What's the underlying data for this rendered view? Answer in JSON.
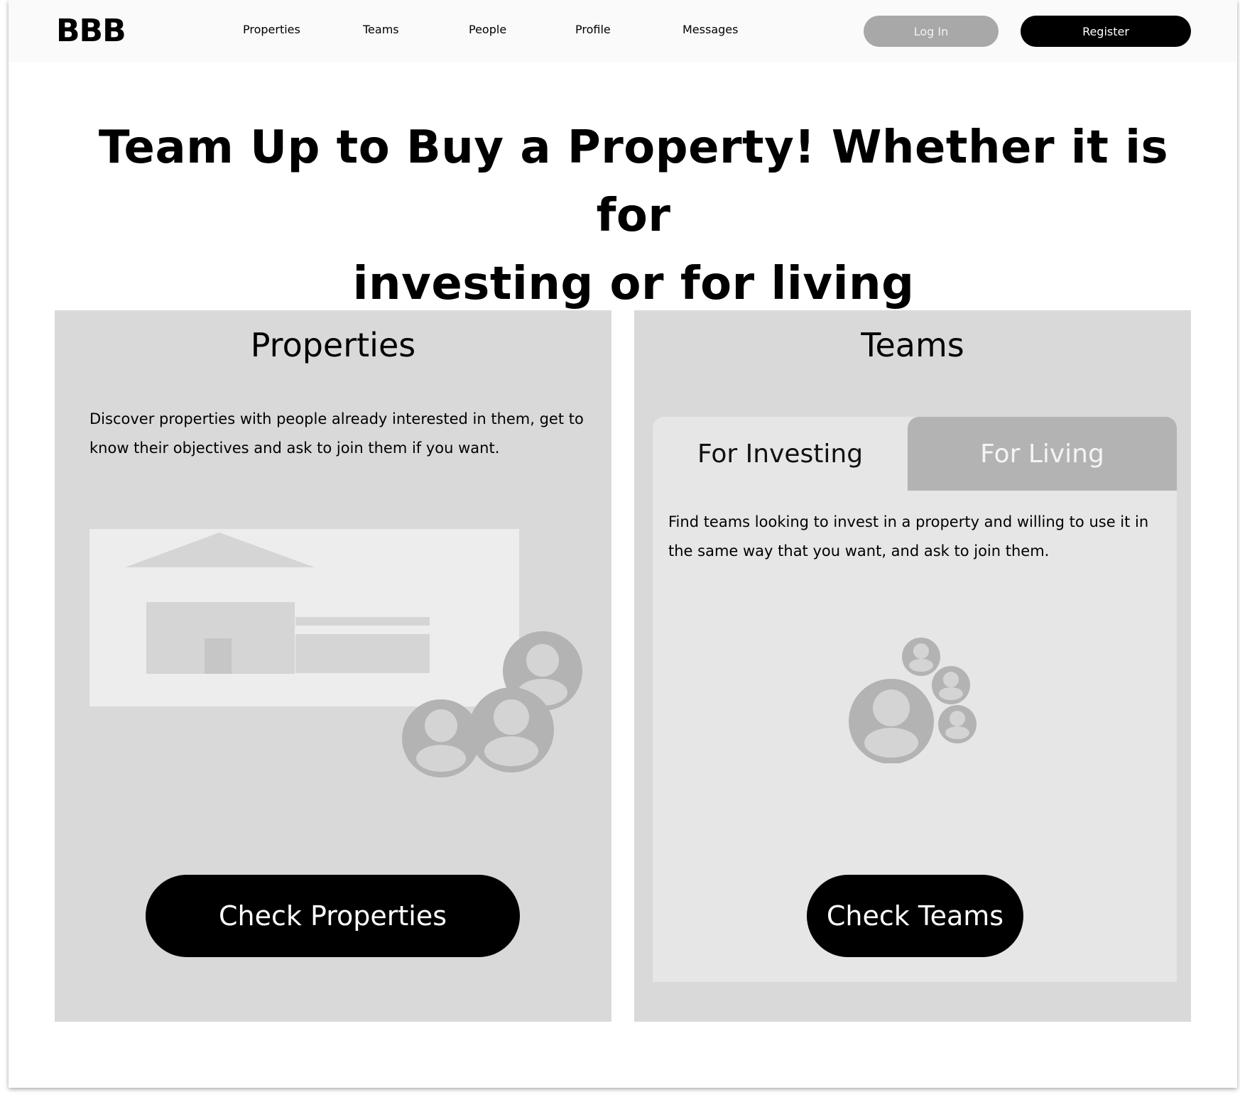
{
  "header": {
    "logo": "BBB",
    "nav": [
      "Properties",
      "Teams",
      "People",
      "Profile",
      "Messages"
    ],
    "login_label": "Log In",
    "register_label": "Register"
  },
  "hero": {
    "line1": "Team Up to Buy a Property! Whether it is for",
    "line2": "investing or for living"
  },
  "properties_card": {
    "title": "Properties",
    "description": "Discover properties with people already interested in them, get to know their objectives and ask to join them if you want.",
    "button_label": "Check Properties"
  },
  "teams_card": {
    "title": "Teams",
    "tabs": [
      "For Investing",
      "For Living"
    ],
    "active_tab": "For Investing",
    "description": "Find teams looking to invest in a property and willing to use it in the same way that you want, and ask to join them.",
    "button_label": "Check Teams"
  },
  "colors": {
    "card_bg": "#d9d9d9",
    "tab_panel_bg": "#e6e6e6",
    "tab_inactive_bg": "#b3b3b3",
    "button_dark": "#000000",
    "button_login": "#a8a8a8"
  }
}
